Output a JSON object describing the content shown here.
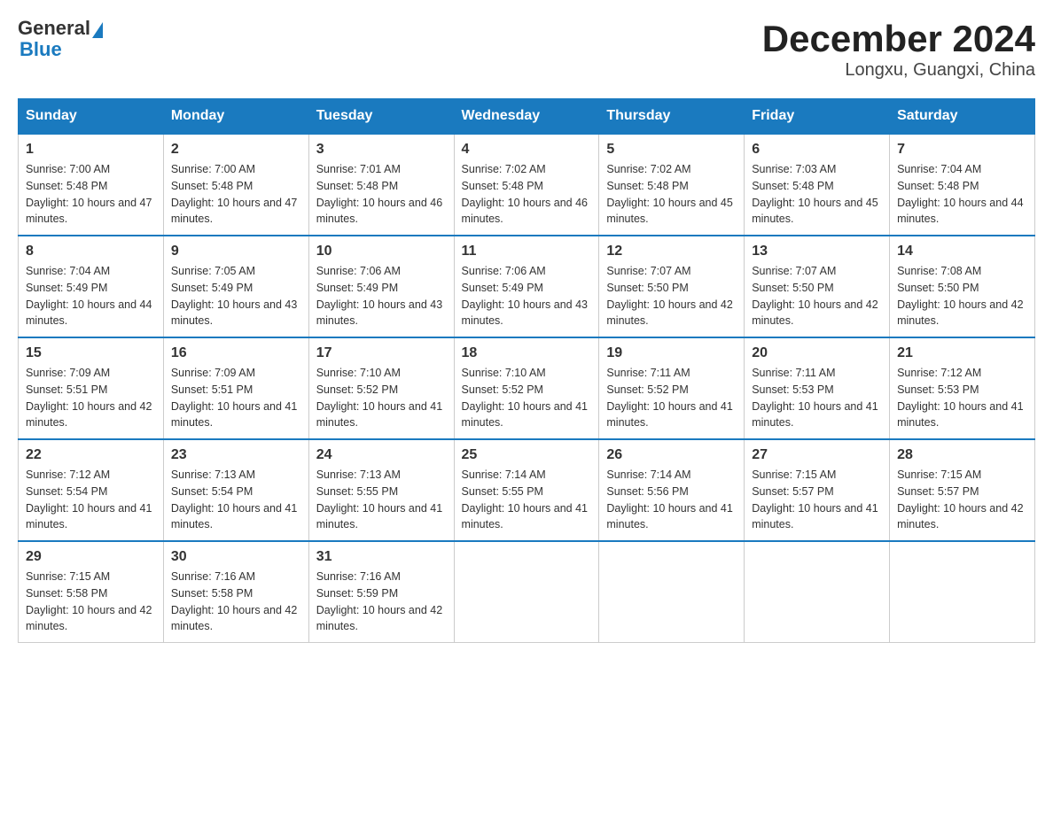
{
  "logo": {
    "text_general": "General",
    "text_blue": "Blue"
  },
  "title": "December 2024",
  "subtitle": "Longxu, Guangxi, China",
  "weekdays": [
    "Sunday",
    "Monday",
    "Tuesday",
    "Wednesday",
    "Thursday",
    "Friday",
    "Saturday"
  ],
  "weeks": [
    [
      {
        "day": "1",
        "sunrise": "7:00 AM",
        "sunset": "5:48 PM",
        "daylight": "10 hours and 47 minutes."
      },
      {
        "day": "2",
        "sunrise": "7:00 AM",
        "sunset": "5:48 PM",
        "daylight": "10 hours and 47 minutes."
      },
      {
        "day": "3",
        "sunrise": "7:01 AM",
        "sunset": "5:48 PM",
        "daylight": "10 hours and 46 minutes."
      },
      {
        "day": "4",
        "sunrise": "7:02 AM",
        "sunset": "5:48 PM",
        "daylight": "10 hours and 46 minutes."
      },
      {
        "day": "5",
        "sunrise": "7:02 AM",
        "sunset": "5:48 PM",
        "daylight": "10 hours and 45 minutes."
      },
      {
        "day": "6",
        "sunrise": "7:03 AM",
        "sunset": "5:48 PM",
        "daylight": "10 hours and 45 minutes."
      },
      {
        "day": "7",
        "sunrise": "7:04 AM",
        "sunset": "5:48 PM",
        "daylight": "10 hours and 44 minutes."
      }
    ],
    [
      {
        "day": "8",
        "sunrise": "7:04 AM",
        "sunset": "5:49 PM",
        "daylight": "10 hours and 44 minutes."
      },
      {
        "day": "9",
        "sunrise": "7:05 AM",
        "sunset": "5:49 PM",
        "daylight": "10 hours and 43 minutes."
      },
      {
        "day": "10",
        "sunrise": "7:06 AM",
        "sunset": "5:49 PM",
        "daylight": "10 hours and 43 minutes."
      },
      {
        "day": "11",
        "sunrise": "7:06 AM",
        "sunset": "5:49 PM",
        "daylight": "10 hours and 43 minutes."
      },
      {
        "day": "12",
        "sunrise": "7:07 AM",
        "sunset": "5:50 PM",
        "daylight": "10 hours and 42 minutes."
      },
      {
        "day": "13",
        "sunrise": "7:07 AM",
        "sunset": "5:50 PM",
        "daylight": "10 hours and 42 minutes."
      },
      {
        "day": "14",
        "sunrise": "7:08 AM",
        "sunset": "5:50 PM",
        "daylight": "10 hours and 42 minutes."
      }
    ],
    [
      {
        "day": "15",
        "sunrise": "7:09 AM",
        "sunset": "5:51 PM",
        "daylight": "10 hours and 42 minutes."
      },
      {
        "day": "16",
        "sunrise": "7:09 AM",
        "sunset": "5:51 PM",
        "daylight": "10 hours and 41 minutes."
      },
      {
        "day": "17",
        "sunrise": "7:10 AM",
        "sunset": "5:52 PM",
        "daylight": "10 hours and 41 minutes."
      },
      {
        "day": "18",
        "sunrise": "7:10 AM",
        "sunset": "5:52 PM",
        "daylight": "10 hours and 41 minutes."
      },
      {
        "day": "19",
        "sunrise": "7:11 AM",
        "sunset": "5:52 PM",
        "daylight": "10 hours and 41 minutes."
      },
      {
        "day": "20",
        "sunrise": "7:11 AM",
        "sunset": "5:53 PM",
        "daylight": "10 hours and 41 minutes."
      },
      {
        "day": "21",
        "sunrise": "7:12 AM",
        "sunset": "5:53 PM",
        "daylight": "10 hours and 41 minutes."
      }
    ],
    [
      {
        "day": "22",
        "sunrise": "7:12 AM",
        "sunset": "5:54 PM",
        "daylight": "10 hours and 41 minutes."
      },
      {
        "day": "23",
        "sunrise": "7:13 AM",
        "sunset": "5:54 PM",
        "daylight": "10 hours and 41 minutes."
      },
      {
        "day": "24",
        "sunrise": "7:13 AM",
        "sunset": "5:55 PM",
        "daylight": "10 hours and 41 minutes."
      },
      {
        "day": "25",
        "sunrise": "7:14 AM",
        "sunset": "5:55 PM",
        "daylight": "10 hours and 41 minutes."
      },
      {
        "day": "26",
        "sunrise": "7:14 AM",
        "sunset": "5:56 PM",
        "daylight": "10 hours and 41 minutes."
      },
      {
        "day": "27",
        "sunrise": "7:15 AM",
        "sunset": "5:57 PM",
        "daylight": "10 hours and 41 minutes."
      },
      {
        "day": "28",
        "sunrise": "7:15 AM",
        "sunset": "5:57 PM",
        "daylight": "10 hours and 42 minutes."
      }
    ],
    [
      {
        "day": "29",
        "sunrise": "7:15 AM",
        "sunset": "5:58 PM",
        "daylight": "10 hours and 42 minutes."
      },
      {
        "day": "30",
        "sunrise": "7:16 AM",
        "sunset": "5:58 PM",
        "daylight": "10 hours and 42 minutes."
      },
      {
        "day": "31",
        "sunrise": "7:16 AM",
        "sunset": "5:59 PM",
        "daylight": "10 hours and 42 minutes."
      },
      null,
      null,
      null,
      null
    ]
  ]
}
